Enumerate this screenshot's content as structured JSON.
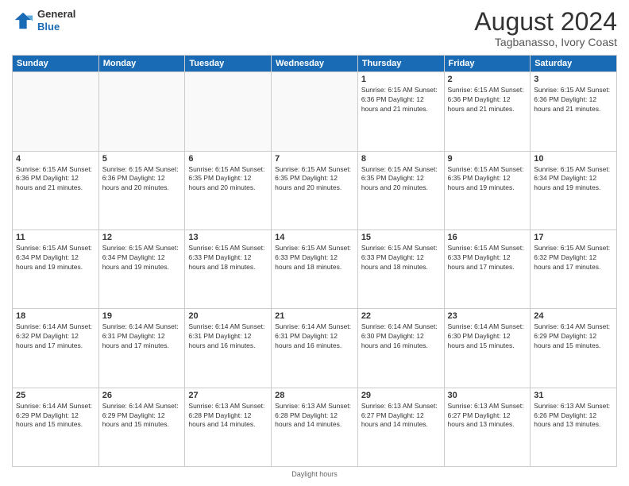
{
  "header": {
    "logo": {
      "general": "General",
      "blue": "Blue"
    },
    "title": "August 2024",
    "location": "Tagbanasso, Ivory Coast"
  },
  "calendar": {
    "weekdays": [
      "Sunday",
      "Monday",
      "Tuesday",
      "Wednesday",
      "Thursday",
      "Friday",
      "Saturday"
    ],
    "weeks": [
      [
        {
          "day": "",
          "info": ""
        },
        {
          "day": "",
          "info": ""
        },
        {
          "day": "",
          "info": ""
        },
        {
          "day": "",
          "info": ""
        },
        {
          "day": "1",
          "info": "Sunrise: 6:15 AM\nSunset: 6:36 PM\nDaylight: 12 hours\nand 21 minutes."
        },
        {
          "day": "2",
          "info": "Sunrise: 6:15 AM\nSunset: 6:36 PM\nDaylight: 12 hours\nand 21 minutes."
        },
        {
          "day": "3",
          "info": "Sunrise: 6:15 AM\nSunset: 6:36 PM\nDaylight: 12 hours\nand 21 minutes."
        }
      ],
      [
        {
          "day": "4",
          "info": "Sunrise: 6:15 AM\nSunset: 6:36 PM\nDaylight: 12 hours\nand 21 minutes."
        },
        {
          "day": "5",
          "info": "Sunrise: 6:15 AM\nSunset: 6:36 PM\nDaylight: 12 hours\nand 20 minutes."
        },
        {
          "day": "6",
          "info": "Sunrise: 6:15 AM\nSunset: 6:35 PM\nDaylight: 12 hours\nand 20 minutes."
        },
        {
          "day": "7",
          "info": "Sunrise: 6:15 AM\nSunset: 6:35 PM\nDaylight: 12 hours\nand 20 minutes."
        },
        {
          "day": "8",
          "info": "Sunrise: 6:15 AM\nSunset: 6:35 PM\nDaylight: 12 hours\nand 20 minutes."
        },
        {
          "day": "9",
          "info": "Sunrise: 6:15 AM\nSunset: 6:35 PM\nDaylight: 12 hours\nand 19 minutes."
        },
        {
          "day": "10",
          "info": "Sunrise: 6:15 AM\nSunset: 6:34 PM\nDaylight: 12 hours\nand 19 minutes."
        }
      ],
      [
        {
          "day": "11",
          "info": "Sunrise: 6:15 AM\nSunset: 6:34 PM\nDaylight: 12 hours\nand 19 minutes."
        },
        {
          "day": "12",
          "info": "Sunrise: 6:15 AM\nSunset: 6:34 PM\nDaylight: 12 hours\nand 19 minutes."
        },
        {
          "day": "13",
          "info": "Sunrise: 6:15 AM\nSunset: 6:33 PM\nDaylight: 12 hours\nand 18 minutes."
        },
        {
          "day": "14",
          "info": "Sunrise: 6:15 AM\nSunset: 6:33 PM\nDaylight: 12 hours\nand 18 minutes."
        },
        {
          "day": "15",
          "info": "Sunrise: 6:15 AM\nSunset: 6:33 PM\nDaylight: 12 hours\nand 18 minutes."
        },
        {
          "day": "16",
          "info": "Sunrise: 6:15 AM\nSunset: 6:33 PM\nDaylight: 12 hours\nand 17 minutes."
        },
        {
          "day": "17",
          "info": "Sunrise: 6:15 AM\nSunset: 6:32 PM\nDaylight: 12 hours\nand 17 minutes."
        }
      ],
      [
        {
          "day": "18",
          "info": "Sunrise: 6:14 AM\nSunset: 6:32 PM\nDaylight: 12 hours\nand 17 minutes."
        },
        {
          "day": "19",
          "info": "Sunrise: 6:14 AM\nSunset: 6:31 PM\nDaylight: 12 hours\nand 17 minutes."
        },
        {
          "day": "20",
          "info": "Sunrise: 6:14 AM\nSunset: 6:31 PM\nDaylight: 12 hours\nand 16 minutes."
        },
        {
          "day": "21",
          "info": "Sunrise: 6:14 AM\nSunset: 6:31 PM\nDaylight: 12 hours\nand 16 minutes."
        },
        {
          "day": "22",
          "info": "Sunrise: 6:14 AM\nSunset: 6:30 PM\nDaylight: 12 hours\nand 16 minutes."
        },
        {
          "day": "23",
          "info": "Sunrise: 6:14 AM\nSunset: 6:30 PM\nDaylight: 12 hours\nand 15 minutes."
        },
        {
          "day": "24",
          "info": "Sunrise: 6:14 AM\nSunset: 6:29 PM\nDaylight: 12 hours\nand 15 minutes."
        }
      ],
      [
        {
          "day": "25",
          "info": "Sunrise: 6:14 AM\nSunset: 6:29 PM\nDaylight: 12 hours\nand 15 minutes."
        },
        {
          "day": "26",
          "info": "Sunrise: 6:14 AM\nSunset: 6:29 PM\nDaylight: 12 hours\nand 15 minutes."
        },
        {
          "day": "27",
          "info": "Sunrise: 6:13 AM\nSunset: 6:28 PM\nDaylight: 12 hours\nand 14 minutes."
        },
        {
          "day": "28",
          "info": "Sunrise: 6:13 AM\nSunset: 6:28 PM\nDaylight: 12 hours\nand 14 minutes."
        },
        {
          "day": "29",
          "info": "Sunrise: 6:13 AM\nSunset: 6:27 PM\nDaylight: 12 hours\nand 14 minutes."
        },
        {
          "day": "30",
          "info": "Sunrise: 6:13 AM\nSunset: 6:27 PM\nDaylight: 12 hours\nand 13 minutes."
        },
        {
          "day": "31",
          "info": "Sunrise: 6:13 AM\nSunset: 6:26 PM\nDaylight: 12 hours\nand 13 minutes."
        }
      ]
    ]
  },
  "footer": {
    "text": "Daylight hours"
  }
}
